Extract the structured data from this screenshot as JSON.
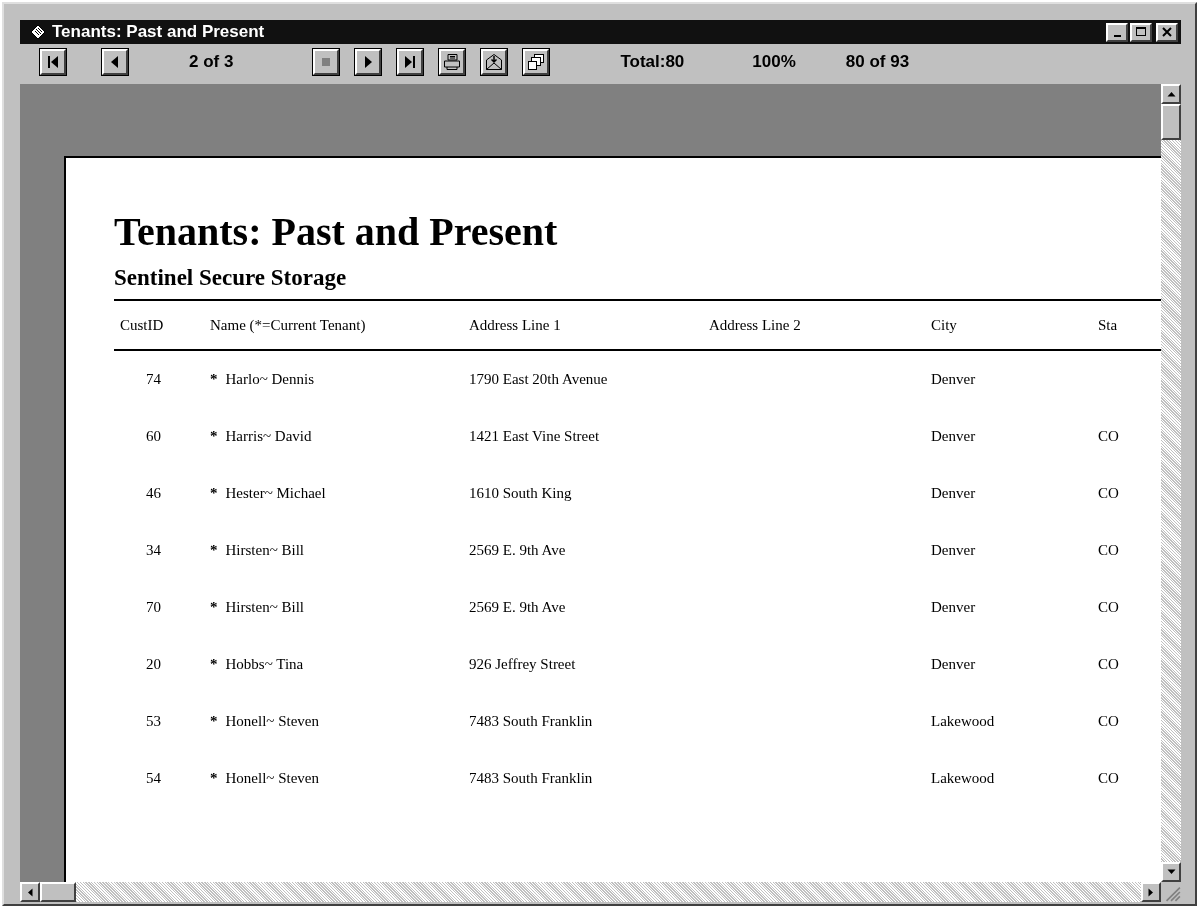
{
  "window": {
    "title": "Tenants: Past and Present"
  },
  "toolbar": {
    "page": "2 of 3",
    "total": "Total:80",
    "zoom": "100%",
    "records": "80 of 93"
  },
  "report": {
    "title": "Tenants: Past and Present",
    "subtitle": "Sentinel Secure Storage",
    "columns": [
      "CustID",
      "Name (*=Current Tenant)",
      "Address Line 1",
      "Address Line 2",
      "City",
      "Sta"
    ],
    "rows": [
      {
        "id": "74",
        "marker": "*",
        "name": "Harlo~ Dennis",
        "address1": "1790 East 20th Avenue",
        "city": "Denver",
        "state": ""
      },
      {
        "id": "60",
        "marker": "*",
        "name": "Harris~ David",
        "address1": "1421 East Vine Street",
        "city": "Denver",
        "state": "CO"
      },
      {
        "id": "46",
        "marker": "*",
        "name": "Hester~ Michael",
        "address1": "1610 South King",
        "city": "Denver",
        "state": "CO"
      },
      {
        "id": "34",
        "marker": "*",
        "name": "Hirsten~ Bill",
        "address1": "2569 E. 9th Ave",
        "city": "Denver",
        "state": "CO"
      },
      {
        "id": "70",
        "marker": "*",
        "name": "Hirsten~ Bill",
        "address1": "2569 E. 9th Ave",
        "city": "Denver",
        "state": "CO"
      },
      {
        "id": "20",
        "marker": "*",
        "name": "Hobbs~ Tina",
        "address1": "926 Jeffrey Street",
        "city": "Denver",
        "state": "CO"
      },
      {
        "id": "53",
        "marker": "*",
        "name": "Honell~ Steven",
        "address1": "7483 South Franklin",
        "city": "Lakewood",
        "state": "CO"
      },
      {
        "id": "54",
        "marker": "*",
        "name": "Honell~ Steven",
        "address1": "7483 South Franklin",
        "city": "Lakewood",
        "state": "CO"
      }
    ]
  }
}
